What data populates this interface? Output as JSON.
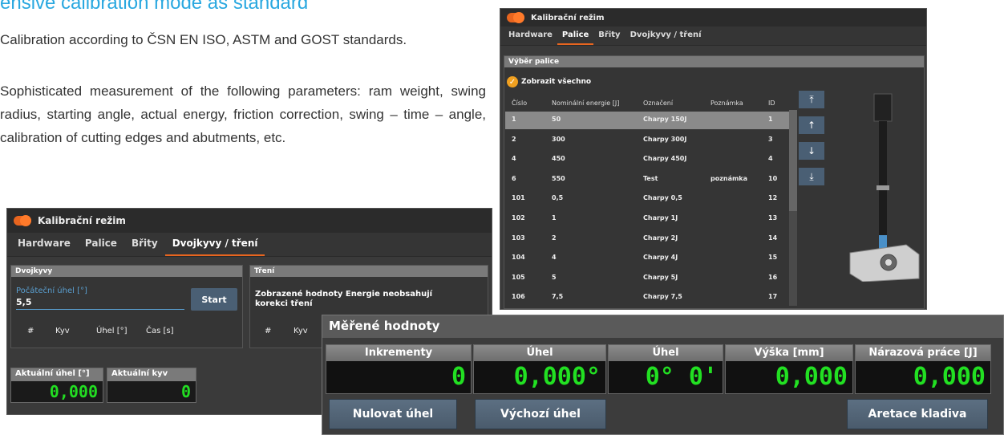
{
  "intro": {
    "heading": "ensive calibration mode as standard",
    "para1": "Calibration according to ČSN EN ISO, ASTM and GOST standards.",
    "para2": "Sophisticated measurement of the following parameters: ram weight, swing radius, starting angle, actual energy, friction correction, swing – time – angle, calibration of cutting edges and abutments, etc."
  },
  "colors": {
    "accent": "#e8651f",
    "value_green": "#22e022",
    "button": "#4a5f74"
  },
  "left_window": {
    "title": "Kalibrační režim",
    "tabs": [
      "Hardware",
      "Palice",
      "Břity",
      "Dvojkyvy / tření"
    ],
    "active_tab": "Dvojkyvy / tření",
    "dvojkyvy": {
      "header": "Dvojkyvy",
      "field_label": "Počáteční úhel [°]",
      "field_value": "5,5",
      "start_button": "Start",
      "columns": [
        "#",
        "Kyv",
        "Úhel [°]",
        "Čas [s]"
      ]
    },
    "treni": {
      "header": "Tření",
      "note": "Zobrazené hodnoty Energie neobsahují korekci tření",
      "columns": [
        "#",
        "Kyv"
      ]
    },
    "current_angle": {
      "label": "Aktuální úhel [°]",
      "value": "0,000"
    },
    "current_swing": {
      "label": "Aktuální kyv",
      "value": "0"
    }
  },
  "right_window": {
    "title": "Kalibrační režim",
    "tabs": [
      "Hardware",
      "Palice",
      "Břity",
      "Dvojkyvy / tření"
    ],
    "active_tab": "Palice",
    "group": "Výběr palice",
    "show_all": "Zobrazit všechno",
    "columns": [
      "Číslo",
      "Nominální energie [J]",
      "Označení",
      "Poznámka",
      "ID"
    ],
    "rows": [
      [
        "1",
        "50",
        "Charpy 150J",
        "",
        "1"
      ],
      [
        "2",
        "300",
        "Charpy 300J",
        "",
        "3"
      ],
      [
        "4",
        "450",
        "Charpy 450J",
        "",
        "4"
      ],
      [
        "6",
        "550",
        "Test",
        "poznámka",
        "10"
      ],
      [
        "101",
        "0,5",
        "Charpy 0,5",
        "",
        "12"
      ],
      [
        "102",
        "1",
        "Charpy 1J",
        "",
        "13"
      ],
      [
        "103",
        "2",
        "Charpy 2J",
        "",
        "14"
      ],
      [
        "104",
        "4",
        "Charpy 4J",
        "",
        "15"
      ],
      [
        "105",
        "5",
        "Charpy 5J",
        "",
        "16"
      ],
      [
        "106",
        "7,5",
        "Charpy 7,5",
        "",
        "17"
      ]
    ],
    "selected_row": 0,
    "nav_icons": [
      "move-top-icon",
      "move-up-icon",
      "move-down-icon",
      "move-bottom-icon"
    ]
  },
  "measure_window": {
    "title": "Měřené hodnoty",
    "columns": [
      {
        "label": "Inkrementy",
        "value": "0"
      },
      {
        "label": "Úhel",
        "value": "0,000°"
      },
      {
        "label": "Úhel",
        "value": "0° 0'"
      },
      {
        "label": "Výška [mm]",
        "value": "0,000"
      },
      {
        "label": "Nárazová práce [J]",
        "value": "0,000"
      }
    ],
    "buttons": [
      "Nulovat úhel",
      "Výchozí úhel",
      "Aretace kladiva"
    ]
  }
}
